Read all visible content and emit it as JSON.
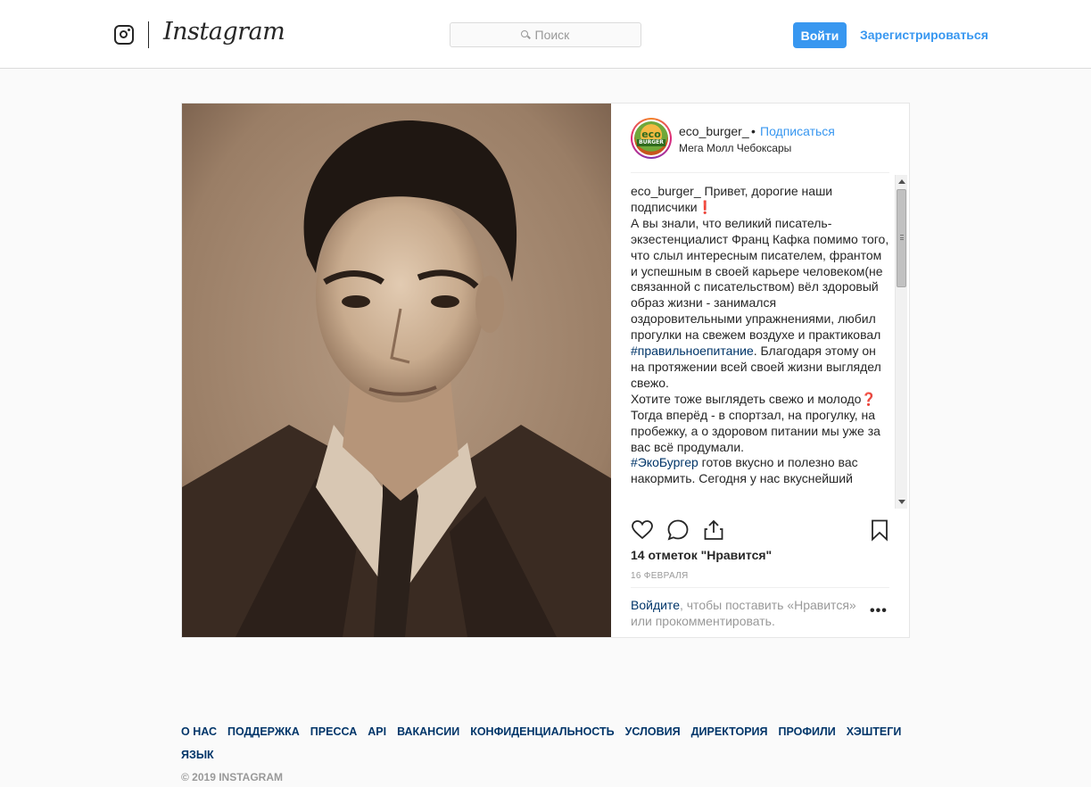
{
  "header": {
    "brand": "Instagram",
    "search_placeholder": "Поиск",
    "login_label": "Войти",
    "signup_label": "Зарегистрироваться"
  },
  "post": {
    "avatar_text_top": "eco",
    "avatar_text_bottom": "BURGER",
    "username": "eco_burger_",
    "separator": "•",
    "follow_label": "Подписаться",
    "location": "Мега Молл Чебоксары",
    "caption_user": "eco_burger_",
    "caption_part1": " Привет, дорогие наши подписчики❗\nА вы знали, что великий писатель-экзестенциалист Франц Кафка помимо того, что слыл интересным писателем, франтом и успешным в своей карьере человеком(не связанной с писательством) вёл здоровый образ жизни - занимался оздоровительными упражнениями, любил прогулки на свежем воздухе и практиковал ",
    "caption_tag1": "#правильноепитание",
    "caption_part2": ". Благодаря этому он на протяжении всей своей жизни выглядел свежо.\nХотите тоже выглядеть свежо и молодо❓ Тогда вперёд - в спортзал, на прогулку, на пробежку, а о здоровом питании мы уже за вас всё продумали.\n",
    "caption_tag2": "#ЭкоБургер",
    "caption_part3": " готов вкусно и полезно вас накормить. Сегодня у нас вкуснейший",
    "likes": "14 отметок \"Нравится\"",
    "date": "16 ФЕВРАЛЯ",
    "login_link": "Войдите",
    "login_rest": ", чтобы поставить «Нравится» или прокомментировать.",
    "more": "•••",
    "icons": [
      "heart-icon",
      "comment-icon",
      "share-icon",
      "bookmark-icon",
      "search-icon",
      "instagram-glyph-icon"
    ]
  },
  "footer": {
    "links": [
      "О НАС",
      "ПОДДЕРЖКА",
      "ПРЕССА",
      "API",
      "ВАКАНСИИ",
      "КОНФИДЕНЦИАЛЬНОСТЬ",
      "УСЛОВИЯ",
      "ДИРЕКТОРИЯ",
      "ПРОФИЛИ",
      "ХЭШТЕГИ",
      "ЯЗЫК"
    ],
    "copyright": "© 2019 INSTAGRAM"
  },
  "colors": {
    "accent": "#3897f0",
    "link_dark": "#003569",
    "border": "#dbdbdb",
    "background": "#fafafa"
  }
}
